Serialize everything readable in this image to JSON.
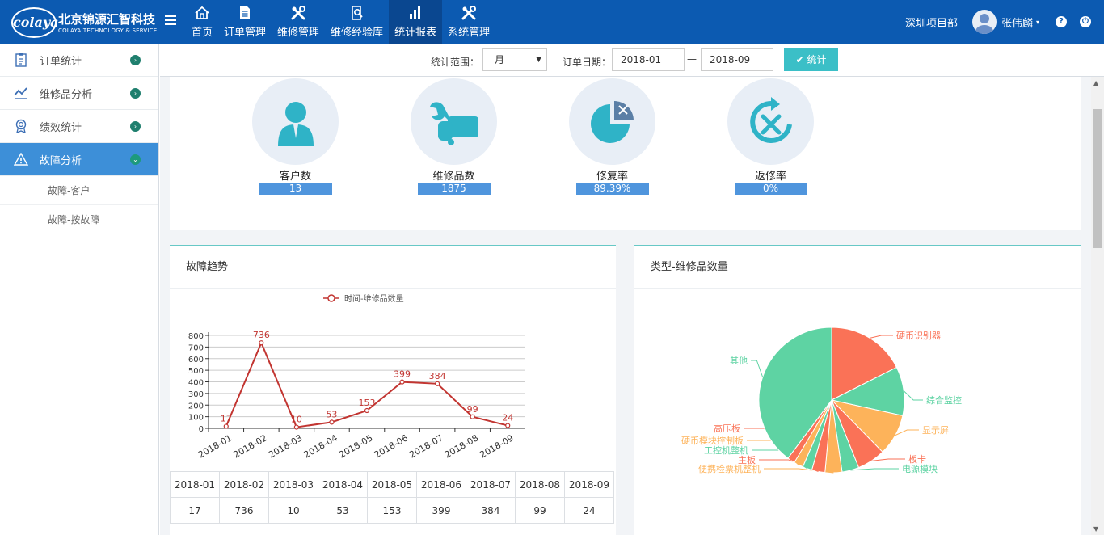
{
  "app": {
    "logo_mark": "colaya",
    "logo_cn": "北京锦源汇智科技",
    "logo_en": "COLAYA TECHNOLOGY & SERVICE"
  },
  "nav": {
    "items": [
      {
        "label": "首页",
        "icon": "home-icon"
      },
      {
        "label": "订单管理",
        "icon": "document-icon"
      },
      {
        "label": "维修管理",
        "icon": "tools-icon"
      },
      {
        "label": "维修经验库",
        "icon": "search-doc-icon"
      },
      {
        "label": "统计报表",
        "icon": "bar-chart-icon",
        "active": true
      },
      {
        "label": "系统管理",
        "icon": "tools-icon"
      }
    ]
  },
  "user": {
    "department": "深圳项目部",
    "name": "张伟麟",
    "caret": "▾",
    "help": "?",
    "power": "⏻"
  },
  "sidebar": {
    "items": [
      {
        "label": "订单统计",
        "icon": "clipboard-icon"
      },
      {
        "label": "维修品分析",
        "icon": "trend-line-icon"
      },
      {
        "label": "绩效统计",
        "icon": "medal-icon"
      },
      {
        "label": "故障分析",
        "icon": "warning-icon",
        "active": true
      }
    ],
    "sub_items": [
      {
        "label": "故障-客户"
      },
      {
        "label": "故障-按故障"
      }
    ],
    "arrow_right": "›",
    "arrow_down": "⌄"
  },
  "filter": {
    "range_label": "统计范围：",
    "range_value": "月",
    "range_caret": "▼",
    "date_label": "订单日期：",
    "date_start": "2018-01",
    "date_sep": "—",
    "date_end": "2018-09",
    "submit_label": "✔ 统计"
  },
  "stats": [
    {
      "label": "客户数",
      "value": "13",
      "icon": "person-icon"
    },
    {
      "label": "维修品数",
      "value": "1875",
      "icon": "wrench-hand-icon"
    },
    {
      "label": "修复率",
      "value": "89.39%",
      "icon": "pie-icon"
    },
    {
      "label": "返修率",
      "value": "0%",
      "icon": "refresh-tools-icon"
    }
  ],
  "trend_card": {
    "title": "故障趋势"
  },
  "type_card": {
    "title": "类型-维修品数量"
  },
  "colors": {
    "topbar": "#0c5ab1",
    "accent": "#3bbfc7",
    "line": "#c23531"
  },
  "chart_data": [
    {
      "type": "line",
      "legend": [
        "时间-维修品数量"
      ],
      "legend_position": "top",
      "x": [
        "2018-01",
        "2018-02",
        "2018-03",
        "2018-04",
        "2018-05",
        "2018-06",
        "2018-07",
        "2018-08",
        "2018-09"
      ],
      "series": [
        {
          "name": "时间-维修品数量",
          "values": [
            17,
            736,
            10,
            53,
            153,
            399,
            384,
            99,
            24
          ]
        }
      ],
      "ylim": [
        0,
        800
      ],
      "yticks": [
        0,
        100,
        200,
        300,
        400,
        500,
        600,
        700,
        800
      ],
      "grid": true
    },
    {
      "type": "pie",
      "slices": [
        {
          "label": "硬币识别器",
          "color": "#fa7257"
        },
        {
          "label": "综合监控",
          "color": "#5ed3a3"
        },
        {
          "label": "显示屏",
          "color": "#fdb35a"
        },
        {
          "label": "板卡",
          "color": "#fa7257"
        },
        {
          "label": "电源模块",
          "color": "#5ed3a3"
        },
        {
          "label": "便携检票机整机",
          "color": "#fdb35a"
        },
        {
          "label": "主板",
          "color": "#fa7257"
        },
        {
          "label": "工控机整机",
          "color": "#5ed3a3"
        },
        {
          "label": "硬币模块控制板",
          "color": "#fdb35a"
        },
        {
          "label": "高压板",
          "color": "#fa7257"
        },
        {
          "label": "其他",
          "color": "#5ed3a3"
        }
      ],
      "values": [
        210,
        130,
        110,
        75,
        45,
        45,
        35,
        25,
        25,
        20,
        475
      ]
    }
  ]
}
